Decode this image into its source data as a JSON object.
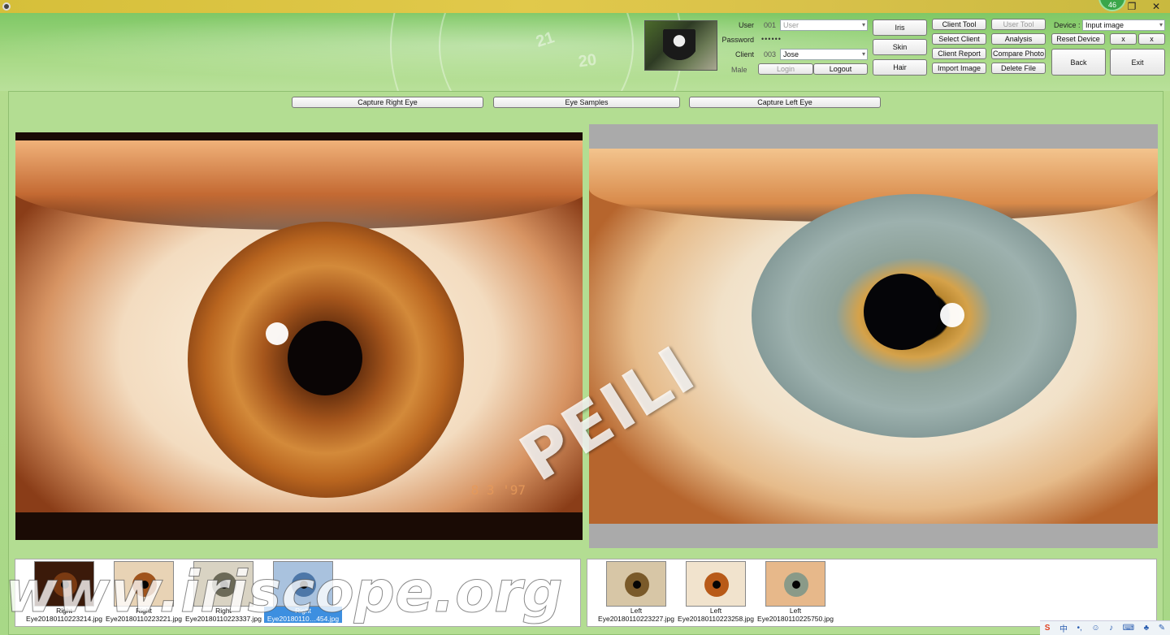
{
  "window": {
    "notification_count": "46",
    "restore_glyph": "❐",
    "close_glyph": "✕"
  },
  "header": {
    "dial_numbers": [
      "21",
      "20"
    ],
    "login": {
      "user_label": "User",
      "user_id": "001",
      "user_value": "User",
      "password_label": "Password",
      "password_mask": "••••••",
      "client_label": "Client",
      "client_id": "003",
      "client_value": "Jose",
      "gender": "Male",
      "login_button": "Login",
      "logout_button": "Logout"
    },
    "mode_buttons": {
      "iris": "Iris",
      "skin": "Skin",
      "hair": "Hair"
    },
    "tools": {
      "client_tool": "Client Tool",
      "select_client": "Select Client",
      "client_report": "Client Report",
      "import_image": "Import Image",
      "user_tool": "User Tool",
      "analysis": "Analysis",
      "compare_photo": "Compare Photo",
      "delete_file": "Delete File"
    },
    "device": {
      "label": "Device :",
      "value": "Input image",
      "reset_button": "Reset Device",
      "x1": "x",
      "x2": "x",
      "back_button": "Back",
      "exit_button": "Exit"
    }
  },
  "main": {
    "capture_right": "Capture Right Eye",
    "eye_samples": "Eye Samples",
    "capture_left": "Capture Left Eye",
    "date_stamp": "8 3 '97",
    "watermark": "PEILI"
  },
  "thumbnails": {
    "right": [
      {
        "side": "Right",
        "file": "Eye20180110223214.jpg",
        "iris_color": "#7a3a12"
      },
      {
        "side": "Right",
        "file": "Eye20180110223221.jpg",
        "iris_color": "#a0541c"
      },
      {
        "side": "Right",
        "file": "Eye20180110223337.jpg",
        "iris_color": "#6c6a58"
      },
      {
        "side": "Right",
        "file": "Eye20180110…454.jpg",
        "iris_color": "#4d77a8"
      }
    ],
    "left": [
      {
        "side": "Left",
        "file": "Eye20180110223227.jpg",
        "iris_color": "#7a5a2a"
      },
      {
        "side": "Left",
        "file": "Eye20180110223258.jpg",
        "iris_color": "#b85a18"
      },
      {
        "side": "Left",
        "file": "Eye20180110225750.jpg",
        "iris_color": "#8a9a88"
      }
    ]
  },
  "site_watermark": "www.iriscope.org",
  "tray": {
    "ime_label": "中",
    "punct": "•,"
  },
  "colors": {
    "accent_green": "#a8d887",
    "selection_blue": "#3d8fe0"
  }
}
